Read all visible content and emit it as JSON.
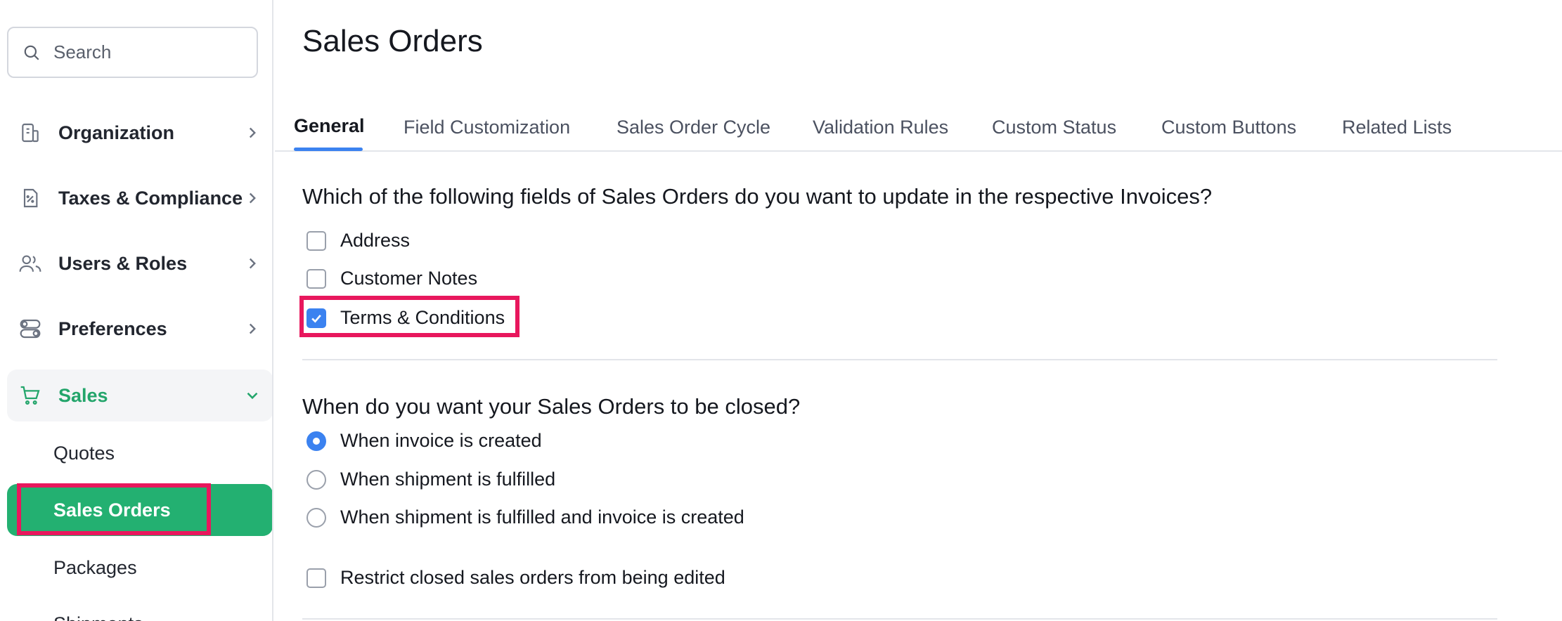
{
  "search": {
    "placeholder": "Search"
  },
  "sidebar": {
    "items": [
      {
        "label": "Organization",
        "icon": "building-icon"
      },
      {
        "label": "Taxes & Compliance",
        "icon": "tax-document-icon"
      },
      {
        "label": "Users & Roles",
        "icon": "users-icon"
      },
      {
        "label": "Preferences",
        "icon": "toggles-icon"
      },
      {
        "label": "Sales",
        "icon": "cart-icon",
        "expanded": true
      }
    ],
    "sales_subitems": [
      {
        "label": "Quotes"
      },
      {
        "label": "Sales Orders",
        "selected": true
      },
      {
        "label": "Packages"
      },
      {
        "label": "Shipments"
      }
    ]
  },
  "main": {
    "title": "Sales Orders",
    "tabs": [
      {
        "label": "General",
        "active": true
      },
      {
        "label": "Field Customization"
      },
      {
        "label": "Sales Order Cycle"
      },
      {
        "label": "Validation Rules"
      },
      {
        "label": "Custom Status"
      },
      {
        "label": "Custom Buttons"
      },
      {
        "label": "Related Lists"
      }
    ],
    "invoice_fields": {
      "question": "Which of the following fields of Sales Orders do you want to update in the respective Invoices?",
      "options": [
        {
          "label": "Address",
          "checked": false
        },
        {
          "label": "Customer Notes",
          "checked": false
        },
        {
          "label": "Terms & Conditions",
          "checked": true
        }
      ]
    },
    "close_condition": {
      "question": "When do you want your Sales Orders to be closed?",
      "options": [
        {
          "label": "When invoice is created",
          "selected": true
        },
        {
          "label": "When shipment is fulfilled",
          "selected": false
        },
        {
          "label": "When shipment is fulfilled and invoice is created",
          "selected": false
        }
      ]
    },
    "restrict_edit": {
      "label": "Restrict closed sales orders from being edited",
      "checked": false
    }
  },
  "colors": {
    "accent_green": "#23b071",
    "checkbox_blue": "#3b82f0",
    "highlight_pink": "#e8175d"
  }
}
